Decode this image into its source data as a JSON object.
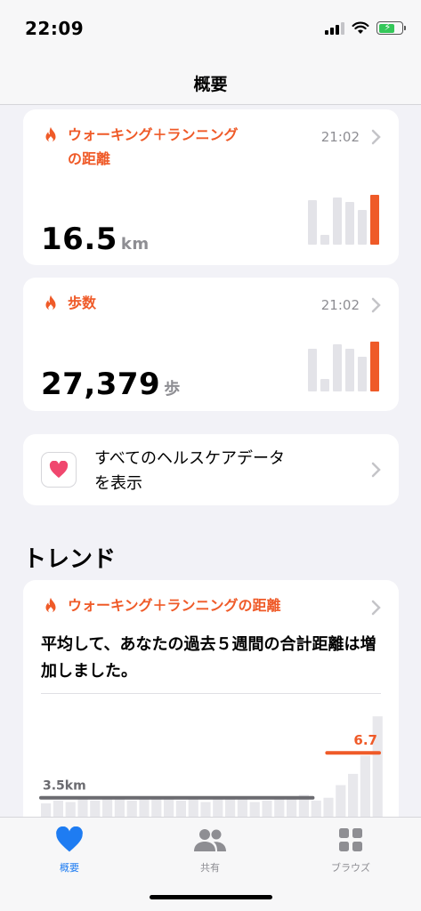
{
  "status_bar": {
    "time": "22:09"
  },
  "nav": {
    "title": "概要"
  },
  "cards": [
    {
      "title_line1": "ウォーキング＋ランニング",
      "title_line2": "の距離",
      "time": "21:02",
      "value": "16.5",
      "unit": "km",
      "mini_chart": {
        "values": [
          0.9,
          0.2,
          0.95,
          0.85,
          0.7,
          1.0
        ],
        "highlight_index": 5
      }
    },
    {
      "title": "歩数",
      "time": "21:02",
      "value": "27,379",
      "unit": "歩",
      "mini_chart": {
        "values": [
          0.85,
          0.25,
          0.95,
          0.85,
          0.7,
          1.0
        ],
        "highlight_index": 5
      }
    }
  ],
  "health_link": {
    "line1": "すべてのヘルスケアデータ",
    "line2": "を表示"
  },
  "trends": {
    "section_title": "トレンド",
    "card_title": "ウォーキング＋ランニングの距離",
    "description": "平均して、あなたの過去５週間の合計距離は増加しました。",
    "chart_data": {
      "type": "bar",
      "average_label": "3.5km",
      "recent_label": "6.7",
      "average_value": 3.5,
      "recent_value": 6.7,
      "values": [
        3.1,
        3.3,
        3.2,
        3.4,
        3.3,
        3.4,
        3.6,
        3.3,
        3.4,
        3.5,
        3.4,
        3.3,
        3.4,
        3.2,
        3.6,
        3.5,
        3.4,
        3.2,
        3.3,
        3.5,
        3.6,
        3.7,
        3.3,
        3.5,
        4.4,
        5.2,
        6.5,
        9.3
      ],
      "highlight_from_index": 23
    }
  },
  "tabbar": {
    "items": [
      {
        "label": "概要",
        "active": true
      },
      {
        "label": "共有",
        "active": false
      },
      {
        "label": "ブラウズ",
        "active": false
      }
    ]
  },
  "colors": {
    "accent": "#ef5a28",
    "tab_active": "#1e7cf2",
    "tab_inactive": "#8e8e93",
    "heart": "#f0476e"
  }
}
